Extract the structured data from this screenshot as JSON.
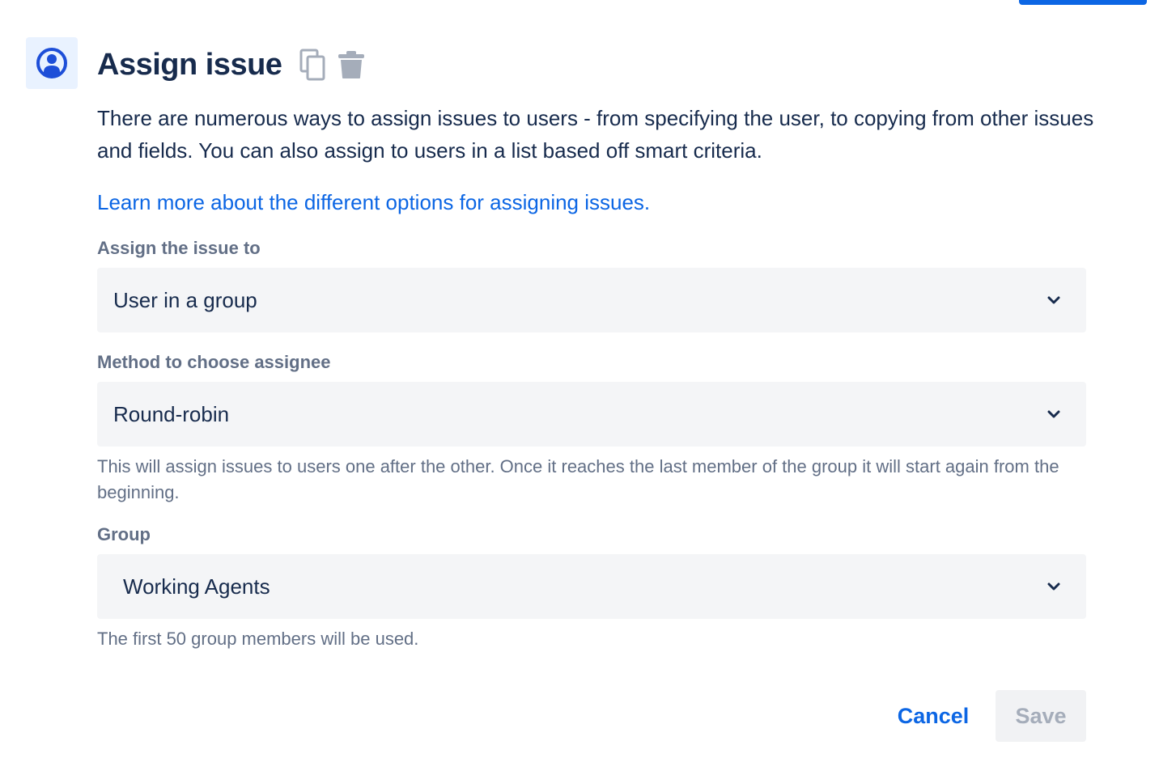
{
  "header": {
    "title": "Assign issue",
    "icon": "user-circle-icon",
    "accent": "#0c66e4"
  },
  "description": "There are numerous ways to assign issues to users - from specifying the user, to copying from other issues and fields. You can also assign to users in a list based off smart criteria.",
  "learn_more_link": "Learn more about the different options for assigning issues.",
  "fields": {
    "assign_to": {
      "label": "Assign the issue to",
      "value": "User in a group"
    },
    "method": {
      "label": "Method to choose assignee",
      "value": "Round-robin",
      "helper": "This will assign issues to users one after the other. Once it reaches the last member of the group it will start again from the beginning."
    },
    "group": {
      "label": "Group",
      "value": "Working Agents",
      "helper": "The first 50 group members will be used."
    }
  },
  "footer": {
    "cancel_label": "Cancel",
    "save_label": "Save"
  }
}
